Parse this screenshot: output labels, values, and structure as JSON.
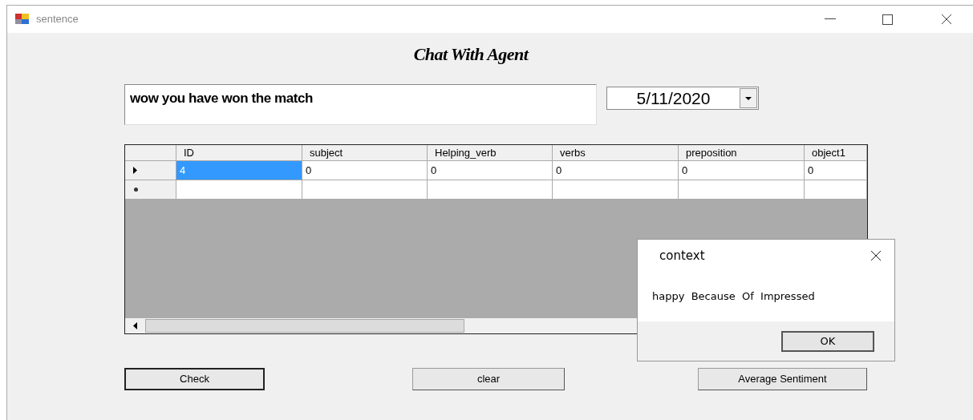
{
  "window": {
    "title": "sentence"
  },
  "heading": "Chat With Agent",
  "message_field": {
    "value": "wow you have won the match"
  },
  "date_picker": {
    "value": "5/11/2020"
  },
  "grid": {
    "columns": [
      "ID",
      "subject",
      "Helping_verb",
      "verbs",
      "preposition",
      "object1"
    ],
    "rows": [
      {
        "kind": "data",
        "cells": [
          {
            "text": "4",
            "selected": true
          },
          {
            "text": "0",
            "selected": false
          },
          {
            "text": "0",
            "selected": false
          },
          {
            "text": "0",
            "selected": false
          },
          {
            "text": "0",
            "selected": false
          },
          {
            "text": "0",
            "selected": false
          }
        ]
      },
      {
        "kind": "new"
      }
    ]
  },
  "buttons": [
    {
      "label": "Check",
      "default": true
    },
    {
      "label": "clear",
      "default": false
    },
    {
      "label": "Average Sentiment",
      "default": false
    }
  ],
  "dialog": {
    "title": "context",
    "message": "happy  Because  Of  Impressed",
    "button": "OK"
  }
}
